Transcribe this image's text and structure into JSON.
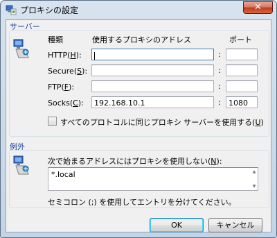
{
  "window": {
    "title": "プロキシの設定",
    "close_glyph": "✕"
  },
  "servers": {
    "group_label": "サーバー",
    "type_header": "種類",
    "address_header": "使用するプロキシのアドレス",
    "port_header": "ポート",
    "rows": [
      {
        "label": "HTTP(",
        "key": "H",
        "suffix": "):",
        "address": "",
        "port": ""
      },
      {
        "label": "Secure(",
        "key": "S",
        "suffix": "):",
        "address": "",
        "port": ""
      },
      {
        "label": "FTP(",
        "key": "F",
        "suffix": "):",
        "address": "",
        "port": ""
      },
      {
        "label": "Socks(",
        "key": "C",
        "suffix": "):",
        "address": "192.168.10.1",
        "port": "1080"
      }
    ],
    "colon": ":",
    "same_proxy_label": "すべてのプロトコルに同じプロキシ サーバーを使用する(",
    "same_proxy_key": "U",
    "same_proxy_suffix": ")",
    "same_proxy_checked": false
  },
  "exceptions": {
    "group_label": "例外",
    "description": "次で始まるアドレスにはプロキシを使用しない(",
    "description_key": "N",
    "description_suffix": "):",
    "value": "*.local",
    "hint": "セミコロン (;) を使用してエントリを分けてください。"
  },
  "buttons": {
    "ok": "OK",
    "cancel": "キャンセル"
  }
}
